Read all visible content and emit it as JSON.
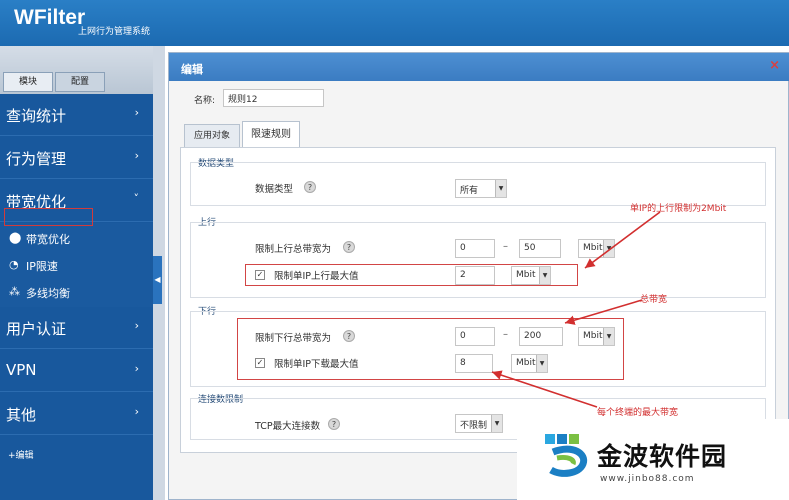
{
  "header": {
    "logo": "WFilter",
    "subtitle": "上网行为管理系统"
  },
  "sidebar": {
    "tabs": [
      "模块",
      "配置"
    ],
    "menus": [
      {
        "label": "查询统计",
        "chev": "›"
      },
      {
        "label": "行为管理",
        "chev": "›"
      },
      {
        "label": "带宽优化",
        "chev": "˅"
      },
      {
        "label": "用户认证",
        "chev": "›"
      },
      {
        "label": "VPN",
        "chev": "›"
      },
      {
        "label": "其他",
        "chev": "›"
      }
    ],
    "submenu": [
      {
        "label": "带宽优化"
      },
      {
        "label": "IP限速"
      },
      {
        "label": "多线均衡"
      }
    ],
    "edit_item": "+编辑",
    "collapse": "◀"
  },
  "dialog": {
    "title": "编辑",
    "close": "×",
    "name_label": "名称:",
    "name_value": "规则12",
    "tabs": [
      "应用对象",
      "限速规则"
    ],
    "data_type": {
      "section": "数据类型",
      "label": "数据类型",
      "value": "所有"
    },
    "upstream": {
      "section": "上行",
      "total_label": "限制上行总带宽为",
      "min": "0",
      "max": "50",
      "unit": "Mbit",
      "single_label": "限制单IP上行最大值",
      "single_value": "2",
      "single_unit": "Mbit"
    },
    "downstream": {
      "section": "下行",
      "total_label": "限制下行总带宽为",
      "min": "0",
      "max": "200",
      "unit": "Mbit",
      "single_label": "限制单IP下载最大值",
      "single_value": "8",
      "single_unit": "Mbit"
    },
    "connections": {
      "section": "连接数限制",
      "label": "TCP最大连接数",
      "value": "不限制"
    },
    "help_glyph": "?",
    "check_glyph": "✓",
    "dropdown_glyph": "▼"
  },
  "annotations": {
    "single_up": "单IP的上行限制为2Mbit",
    "total": "总带宽",
    "per_terminal": "每个终端的最大带宽"
  },
  "watermark": {
    "text": "金波软件园",
    "url": "www.jinbo88.com"
  },
  "colors": {
    "accent": "#1c6ab1",
    "sidebar": "#18589d",
    "annotation": "#d22f2f"
  }
}
